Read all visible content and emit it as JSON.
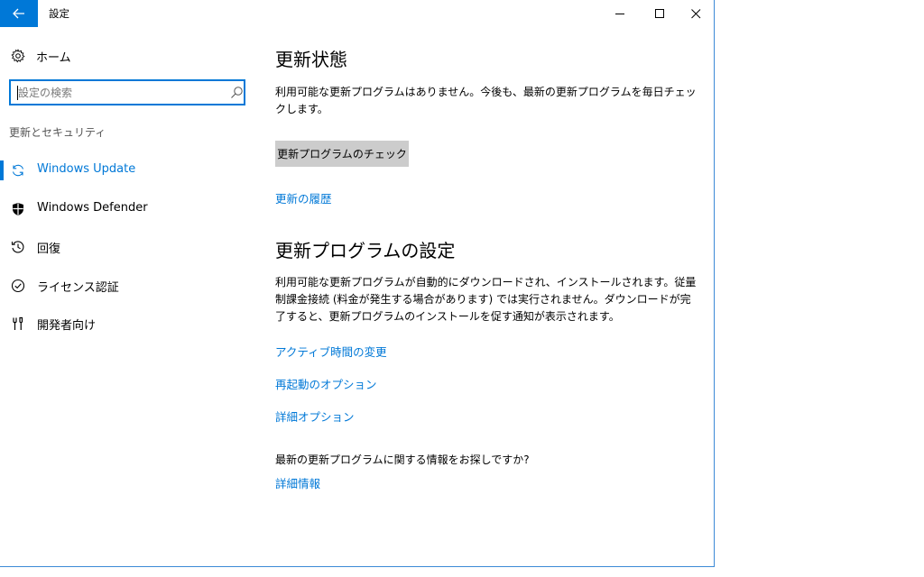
{
  "window": {
    "title": "設定"
  },
  "sidebar": {
    "home_label": "ホーム",
    "search_placeholder": "設定の検索",
    "section_label": "更新とセキュリティ",
    "items": [
      {
        "label": "Windows Update",
        "icon": "sync-icon",
        "active": true
      },
      {
        "label": "Windows Defender",
        "icon": "shield-icon",
        "active": false
      },
      {
        "label": "回復",
        "icon": "history-icon",
        "active": false
      },
      {
        "label": "ライセンス認証",
        "icon": "check-circle-icon",
        "active": false
      },
      {
        "label": "開発者向け",
        "icon": "developer-tools-icon",
        "active": false
      }
    ]
  },
  "main": {
    "status_heading": "更新状態",
    "status_text": "利用可能な更新プログラムはありません。今後も、最新の更新プログラムを毎日チェックします。",
    "check_button": "更新プログラムのチェック",
    "history_link": "更新の履歴",
    "settings_heading": "更新プログラムの設定",
    "settings_text": "利用可能な更新プログラムが自動的にダウンロードされ、インストールされます。従量制課金接続 (料金が発生する場合があります) では実行されません。ダウンロードが完了すると、更新プログラムのインストールを促す通知が表示されます。",
    "links": [
      "アクティブ時間の変更",
      "再起動のオプション",
      "詳細オプション"
    ],
    "info_question": "最新の更新プログラムに関する情報をお探しですか?",
    "info_link": "詳細情報"
  },
  "colors": {
    "accent": "#0078d7",
    "button_bg": "#cccccc",
    "window_border": "#3c8ad6"
  }
}
